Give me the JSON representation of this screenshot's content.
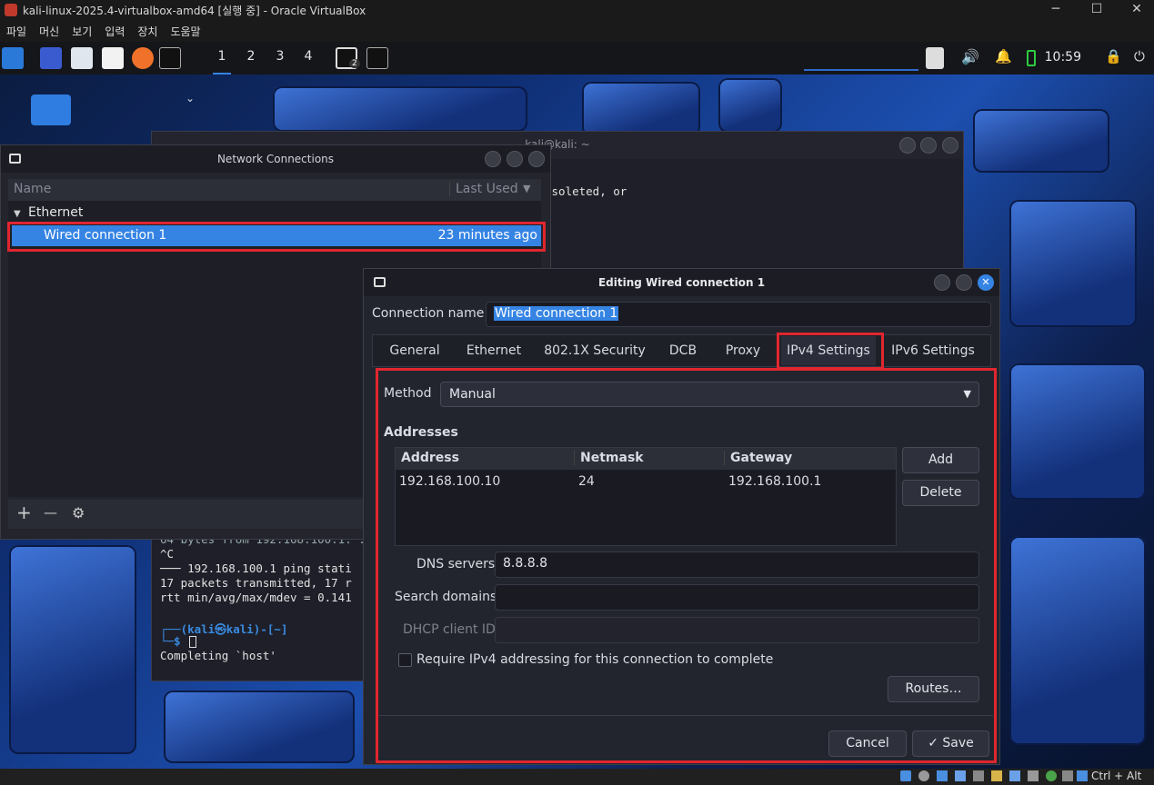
{
  "host_window": {
    "title": "kali-linux-2025.4-virtualbox-amd64 [실행 중] - Oracle VirtualBox",
    "controls": [
      "─",
      "☐",
      "✕"
    ],
    "menu": [
      "파일",
      "머신",
      "보기",
      "입력",
      "장치",
      "도움말"
    ]
  },
  "panel": {
    "workspaces": [
      "1",
      "2",
      "3",
      "4"
    ],
    "notification_count": "2",
    "clock": "10:59"
  },
  "terminal": {
    "title": "kali@kali: ~",
    "lines": [
      "bsoleted, or",
      "64 bytes from 192.168.100.1: ...",
      "^C",
      "─── 192.168.100.1 ping stati",
      "17 packets transmitted, 17 r",
      "rtt min/avg/max/mdev = 0.141"
    ],
    "prompt_top": "┌──(kali㉿kali)-[~]",
    "prompt_bottom": "└─$ ",
    "completing": "Completing `host'"
  },
  "network_connections": {
    "title": "Network Connections",
    "col_name": "Name",
    "col_last_used": "Last Used",
    "group": "Ethernet",
    "connection": {
      "name": "Wired connection 1",
      "last_used": "23 minutes ago"
    },
    "toolbar": {
      "add": "+",
      "remove": "—",
      "settings": "⚙"
    }
  },
  "edit_dialog": {
    "title": "Editing Wired connection 1",
    "connection_name_label": "Connection name",
    "connection_name_value": "Wired connection 1",
    "tabs": [
      "General",
      "Ethernet",
      "802.1X Security",
      "DCB",
      "Proxy",
      "IPv4 Settings",
      "IPv6 Settings"
    ],
    "active_tab": "IPv4 Settings",
    "method_label": "Method",
    "method_value": "Manual",
    "addresses_label": "Addresses",
    "address_columns": [
      "Address",
      "Netmask",
      "Gateway"
    ],
    "addresses": [
      {
        "address": "192.168.100.10",
        "netmask": "24",
        "gateway": "192.168.100.1"
      }
    ],
    "add_label": "Add",
    "delete_label": "Delete",
    "dns_label": "DNS servers",
    "dns_value": "8.8.8.8",
    "search_label": "Search domains",
    "search_value": "",
    "dhcp_label": "DHCP client ID",
    "dhcp_value": "",
    "require_label": "Require IPv4 addressing for this connection to complete",
    "routes_label": "Routes…",
    "cancel_label": "Cancel",
    "save_label": "Save"
  },
  "statusbar": {
    "hotkey": "Ctrl + Alt"
  },
  "colors": {
    "highlight": "#e0262f",
    "selection": "#3584e4"
  }
}
